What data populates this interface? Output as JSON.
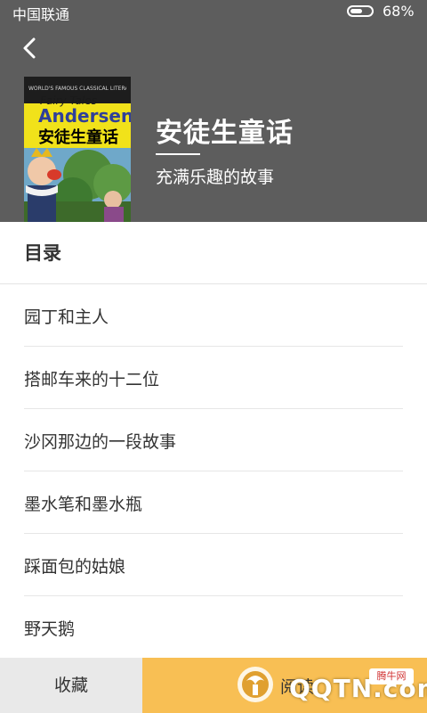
{
  "status": {
    "carrier": "中国联通",
    "battery_pct": "68%",
    "battery_level": 0.68
  },
  "header": {
    "back_icon": "chevron-left-icon",
    "cover": {
      "top_text": "WORLD'S FAMOUS CLASSICAL LITERATURE",
      "fairy_tales": "Fairy Tales",
      "author_en": "Andersen",
      "title_cn": "安徒生童话"
    },
    "title": "安徒生童话",
    "subtitle": "充满乐趣的故事"
  },
  "toc": {
    "heading": "目录",
    "items": [
      "园丁和主人",
      "搭邮车来的十二位",
      "沙冈那边的一段故事",
      "墨水笔和墨水瓶",
      "踩面包的姑娘",
      "野天鹅"
    ]
  },
  "bottom": {
    "favorite_label": "收藏",
    "read_label": "阅读",
    "watermark_text": "QQTN.com",
    "watermark_badge": "腾牛网"
  },
  "colors": {
    "header_bg": "#5d5d5d",
    "read_button_bg": "#f8bf54",
    "favorite_button_bg": "#e9e9e9"
  }
}
